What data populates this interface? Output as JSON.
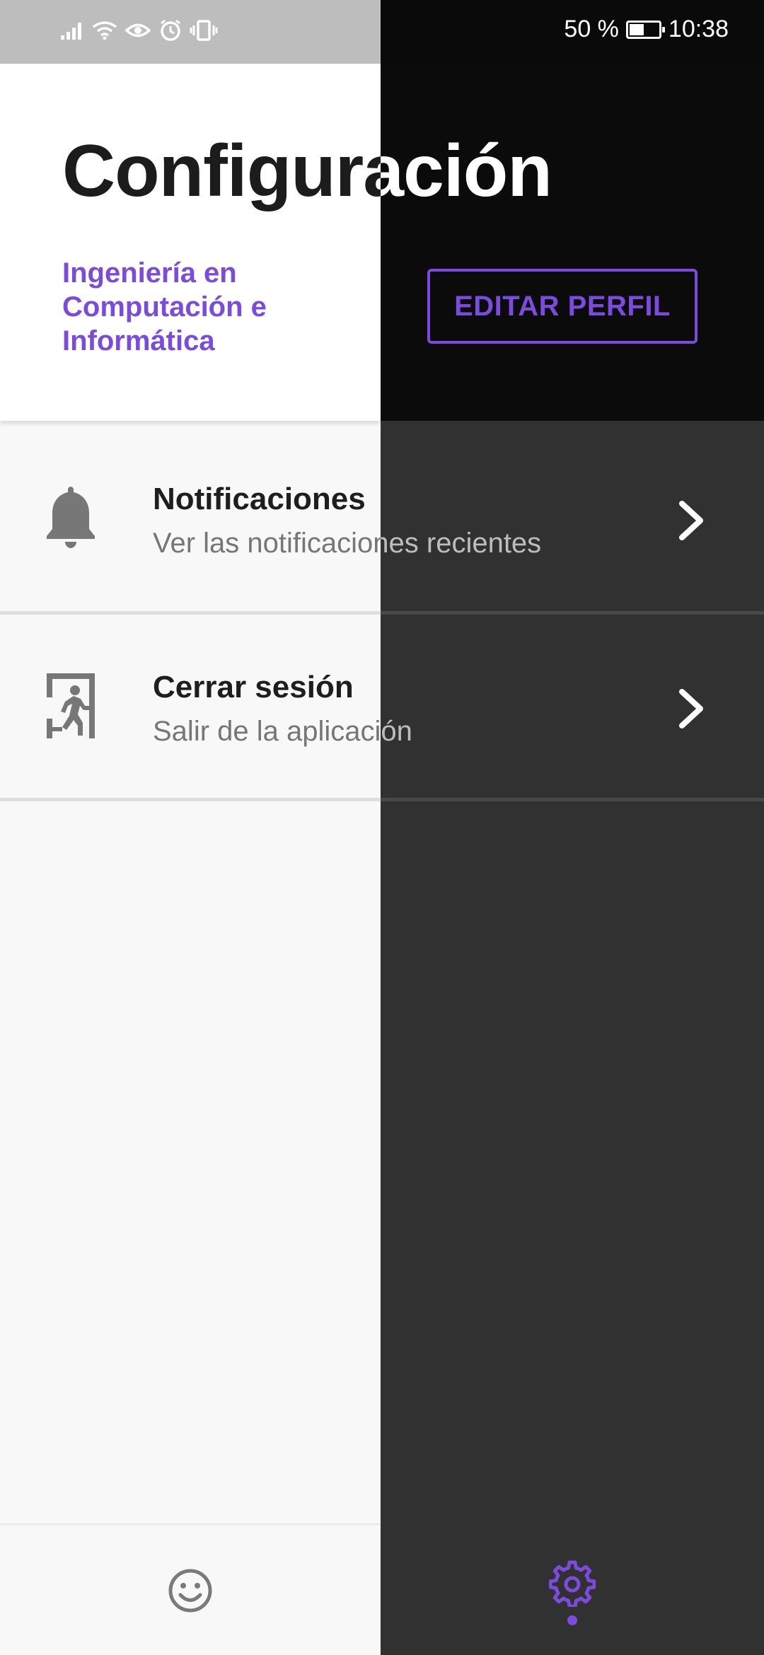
{
  "status_bar": {
    "battery_text": "50 %",
    "battery_level": 0.5,
    "time": "10:38",
    "icons": [
      "signal-icon",
      "wifi-icon",
      "eye-icon",
      "alarm-icon",
      "vibrate-icon"
    ]
  },
  "header": {
    "title": "Configuración",
    "subtitle": "Ingeniería en Computación e Informática",
    "edit_button": "EDITAR PERFIL"
  },
  "settings": [
    {
      "title": "Notificaciones",
      "subtitle": "Ver las notificaciones recientes",
      "icon": "bell-icon"
    },
    {
      "title": "Cerrar sesión",
      "subtitle": "Salir de la aplicación",
      "icon": "exit-door-icon"
    }
  ],
  "bottom_nav": [
    {
      "icon": "smiley-icon",
      "active": false
    },
    {
      "icon": "gear-icon",
      "active": true
    }
  ],
  "colors": {
    "accent": "#7a4bdc",
    "light_background": "#f8f8f8",
    "dark_background": "#313131"
  }
}
